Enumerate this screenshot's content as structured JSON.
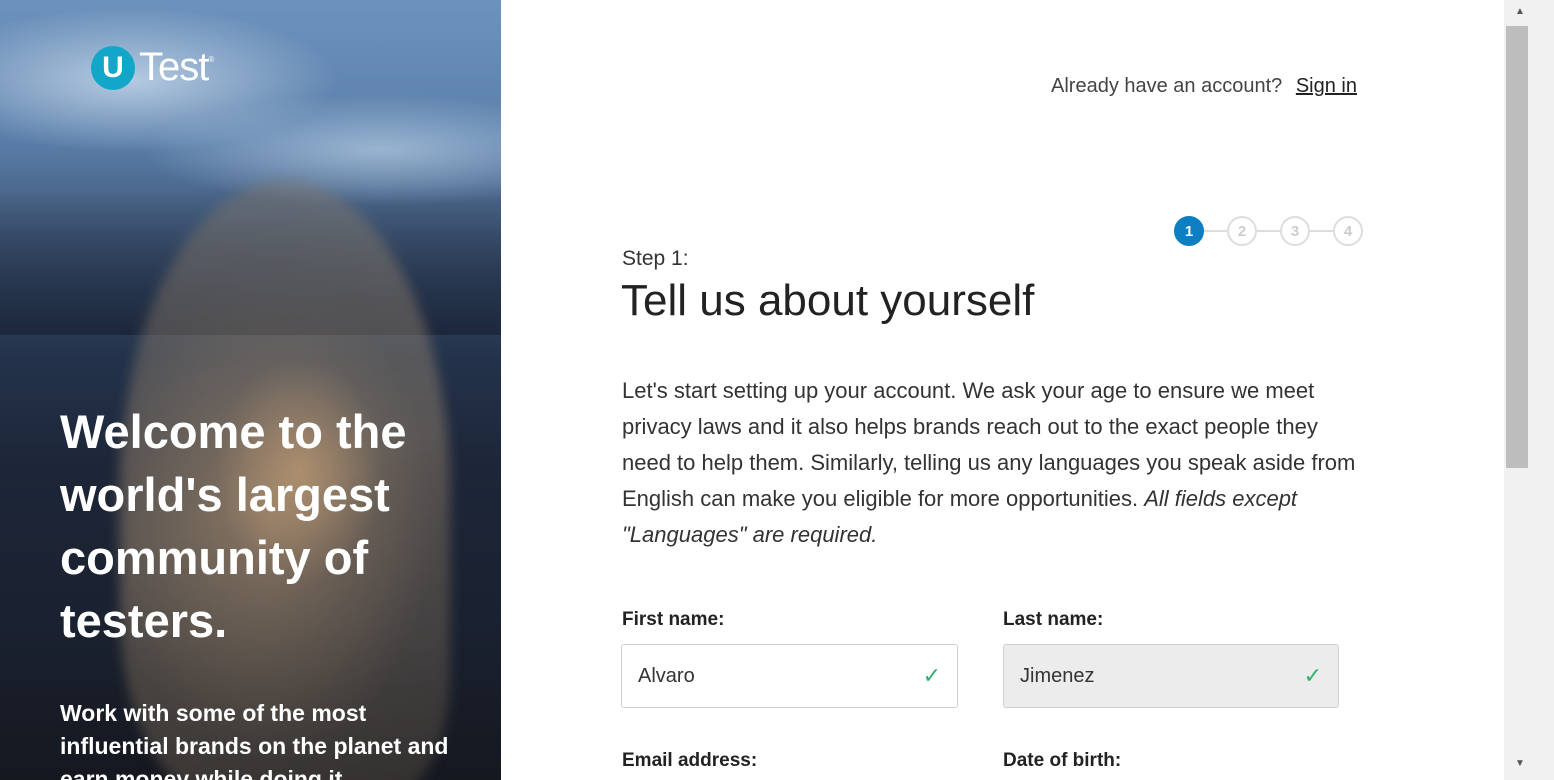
{
  "brand": {
    "logo_letter": "U",
    "logo_name": "Test",
    "logo_mark": "®"
  },
  "hero": {
    "title": "Welcome to the world's largest community of testers.",
    "subtitle": "Work with some of the most influential brands on the planet and earn money while doing it"
  },
  "header": {
    "account_prompt": "Already have an account?",
    "signin_label": "Sign in"
  },
  "stepper": {
    "steps": [
      "1",
      "2",
      "3",
      "4"
    ],
    "active": 1
  },
  "form": {
    "step_label": "Step 1:",
    "title": "Tell us about yourself",
    "intro": "Let's start setting up your account. We ask your age to ensure we meet privacy laws and it also helps brands reach out to the exact people they need to help them. Similarly, telling us any languages you speak aside from English can make you eligible for more opportunities.",
    "intro_note": "All fields except \"Languages\" are required.",
    "first_name": {
      "label": "First name:",
      "value": "Alvaro"
    },
    "last_name": {
      "label": "Last name:",
      "value": "Jimenez"
    },
    "email": {
      "label": "Email address:"
    },
    "dob": {
      "label": "Date of birth:"
    }
  },
  "colors": {
    "accent": "#0b7fc1",
    "logo": "#12a7c9",
    "valid": "#2fb36a"
  },
  "icons": {
    "valid": "check-icon",
    "scroll_up": "arrow-up-icon",
    "scroll_down": "arrow-down-icon"
  }
}
